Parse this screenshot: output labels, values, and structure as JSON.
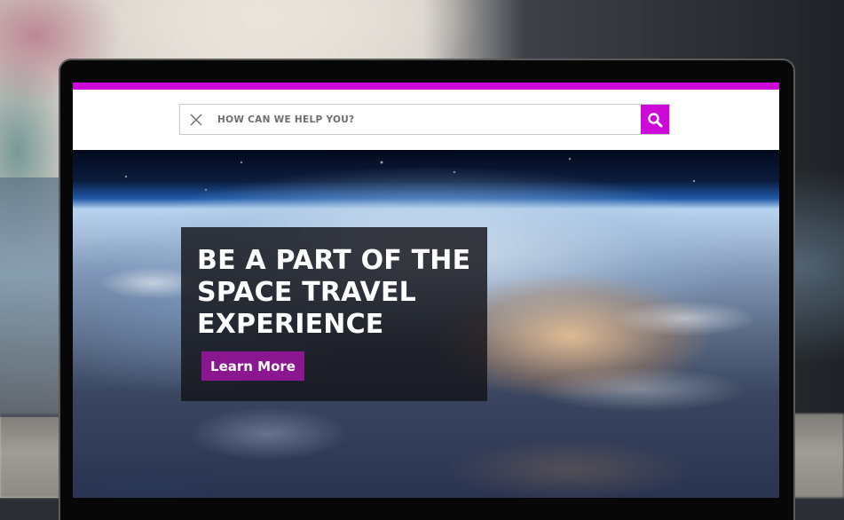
{
  "header": {
    "search": {
      "placeholder": "HOW CAN WE HELP YOU?",
      "value": ""
    },
    "icons": {
      "clear": "close-icon",
      "search": "search-icon"
    }
  },
  "hero": {
    "title": "BE A PART OF THE SPACE TRAVEL EXPERIENCE",
    "cta_label": "Learn More"
  },
  "colors": {
    "accent": "#cc09d6",
    "cta": "#8b1790"
  }
}
